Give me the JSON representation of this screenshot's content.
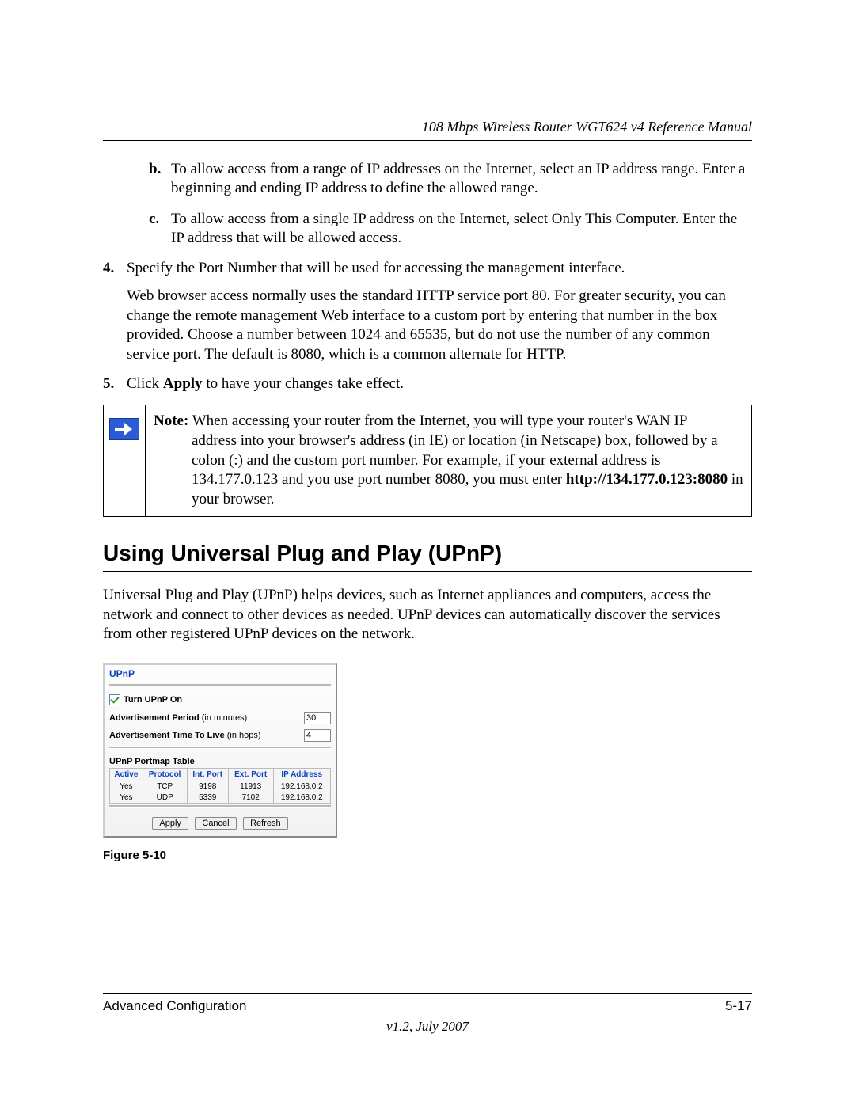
{
  "header": {
    "doc_title": "108 Mbps Wireless Router WGT624 v4 Reference Manual"
  },
  "sublist": {
    "b": {
      "marker": "b.",
      "text": "To allow access from a range of IP addresses on the Internet, select an IP address range. Enter a beginning and ending IP address to define the allowed range."
    },
    "c": {
      "marker": "c.",
      "text": "To allow access from a single IP address on the Internet, select Only This Computer. Enter the IP address that will be allowed access."
    }
  },
  "numlist": {
    "n4": {
      "marker": "4.",
      "text": "Specify the Port Number that will be used for accessing the management interface.",
      "cont": "Web browser access normally uses the standard HTTP service port 80. For greater security, you can change the remote management Web interface to a custom port by entering that number in the box provided. Choose a number between 1024 and 65535, but do not use the number of any common service port. The default is 8080, which is a common alternate for HTTP."
    },
    "n5": {
      "marker": "5.",
      "pre": "Click ",
      "bold": "Apply",
      "post": " to have your changes take effect."
    }
  },
  "note": {
    "lead_bold": "Note:",
    "line1_rest": " When accessing your router from the Internet, you will type your router's WAN IP",
    "line2": "address into your browser's address (in IE) or location (in Netscape) box, followed by a colon (:) and the custom port number. For example, if your external address is 134.177.0.123 and you use port number 8080, you must enter ",
    "url_bold": "http://134.177.0.123:8080",
    "line3_rest": " in your browser."
  },
  "section": {
    "heading": "Using Universal Plug and Play (UPnP)",
    "para": "Universal Plug and Play (UPnP) helps devices, such as Internet appliances and computers, access the network and connect to other devices as needed. UPnP devices can automatically discover the services from other registered UPnP devices on the network."
  },
  "upnp": {
    "title": "UPnP",
    "turn_on": "Turn UPnP On",
    "adv_period_bold": "Advertisement Period",
    "adv_period_rest": " (in minutes)",
    "adv_period_val": "30",
    "adv_ttl_bold": "Advertisement Time To Live",
    "adv_ttl_rest": " (in hops)",
    "adv_ttl_val": "4",
    "portmap_title": "UPnP Portmap Table",
    "headers": {
      "active": "Active",
      "protocol": "Protocol",
      "intport": "Int. Port",
      "extport": "Ext. Port",
      "ip": "IP Address"
    },
    "rows": [
      {
        "active": "Yes",
        "protocol": "TCP",
        "intport": "9198",
        "extport": "11913",
        "ip": "192.168.0.2"
      },
      {
        "active": "Yes",
        "protocol": "UDP",
        "intport": "5339",
        "extport": "7102",
        "ip": "192.168.0.2"
      }
    ],
    "buttons": {
      "apply": "Apply",
      "cancel": "Cancel",
      "refresh": "Refresh"
    }
  },
  "figure_caption": "Figure 5-10",
  "footer": {
    "left": "Advanced Configuration",
    "right": "5-17",
    "version": "v1.2, July 2007"
  }
}
